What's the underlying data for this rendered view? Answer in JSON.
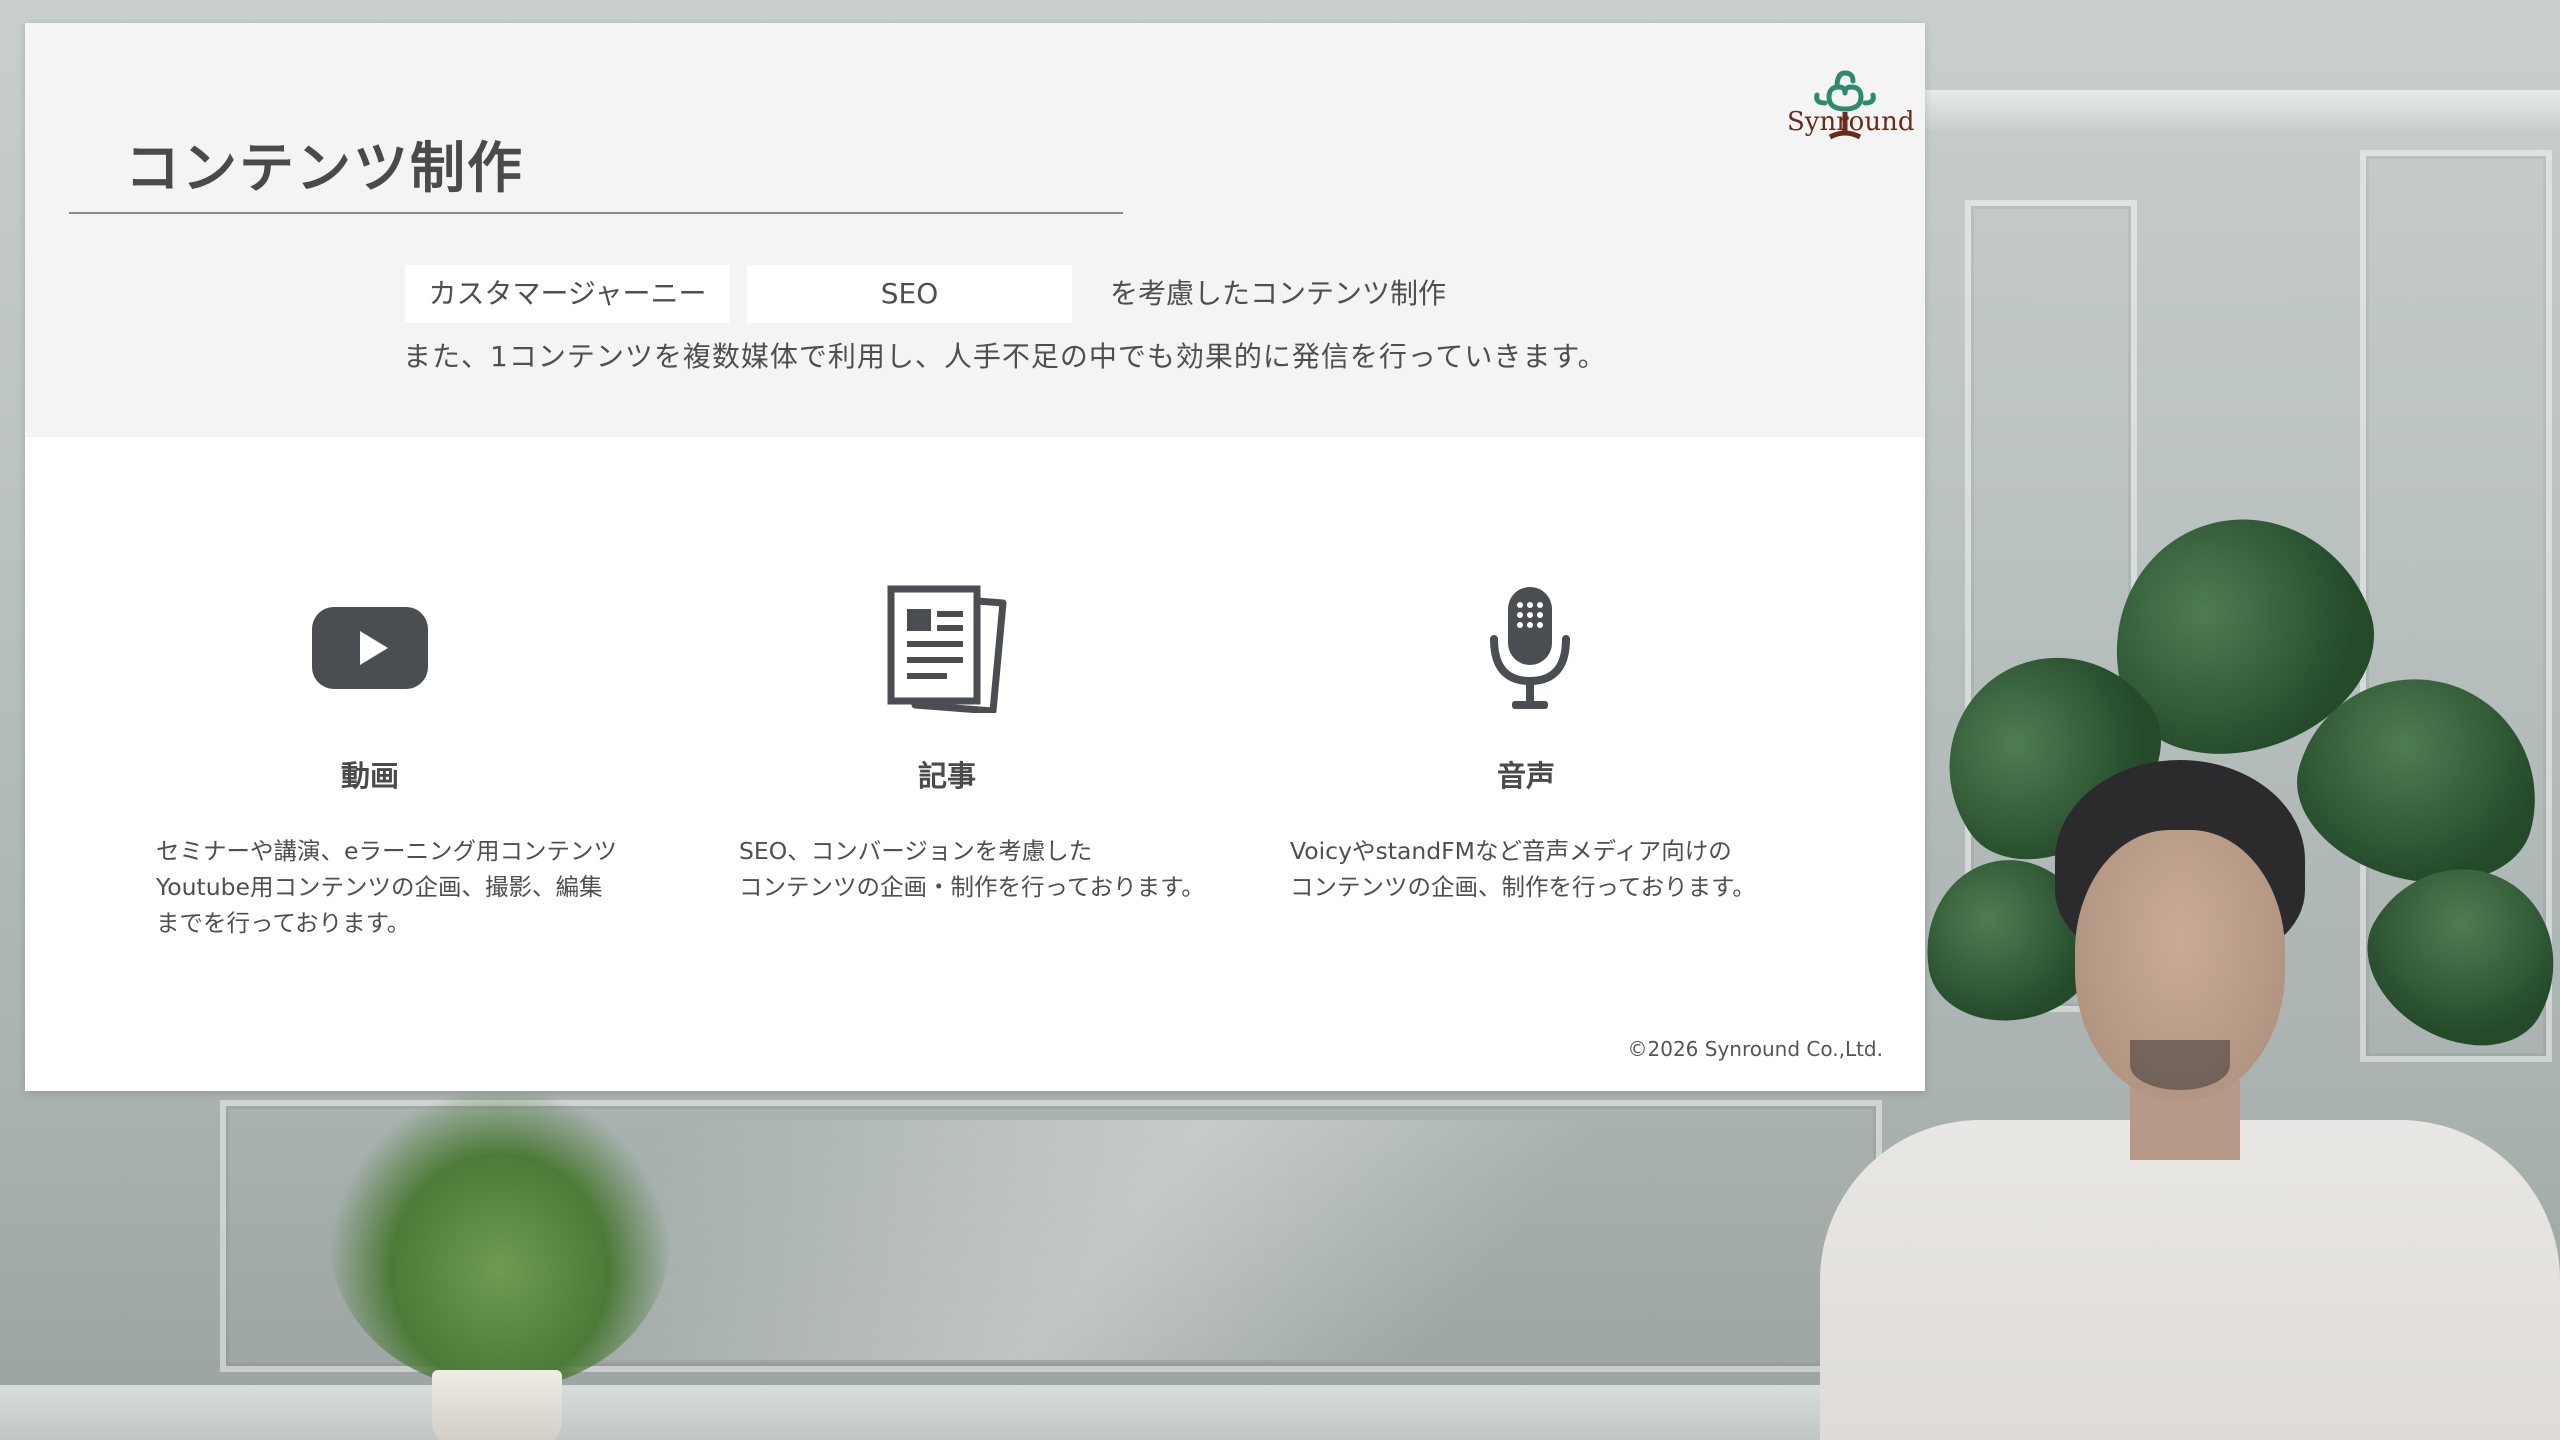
{
  "slide": {
    "title": "コンテンツ制作",
    "logo_text": "Synround",
    "tags": [
      "カスタマージャーニー",
      "SEO"
    ],
    "tag_suffix": "を考慮したコンテンツ制作",
    "intro": "また、1コンテンツを複数媒体で利用し、人手不足の中でも効果的に発信を行っていきます。",
    "columns": [
      {
        "icon": "youtube-play-icon",
        "heading": "動画",
        "lines": [
          "セミナーや講演、eラーニング用コンテンツ",
          "Youtube用コンテンツの企画、撮影、編集",
          "までを行っております。"
        ]
      },
      {
        "icon": "article-document-icon",
        "heading": "記事",
        "lines": [
          "SEO、コンバージョンを考慮した",
          "コンテンツの企画・制作を行っております。"
        ]
      },
      {
        "icon": "microphone-icon",
        "heading": "音声",
        "lines": [
          "VoicyやstandFMなど音声メディア向けの",
          "コンテンツの企画、制作を行っております。"
        ]
      }
    ],
    "copyright": "©2026 Synround Co.,Ltd."
  },
  "colors": {
    "slide_top_bg": "#f4f4f4",
    "text": "#4f4f4f",
    "icon": "#4a4d52",
    "logo_green": "#2e8a6e",
    "logo_brown": "#6b2a1a"
  }
}
